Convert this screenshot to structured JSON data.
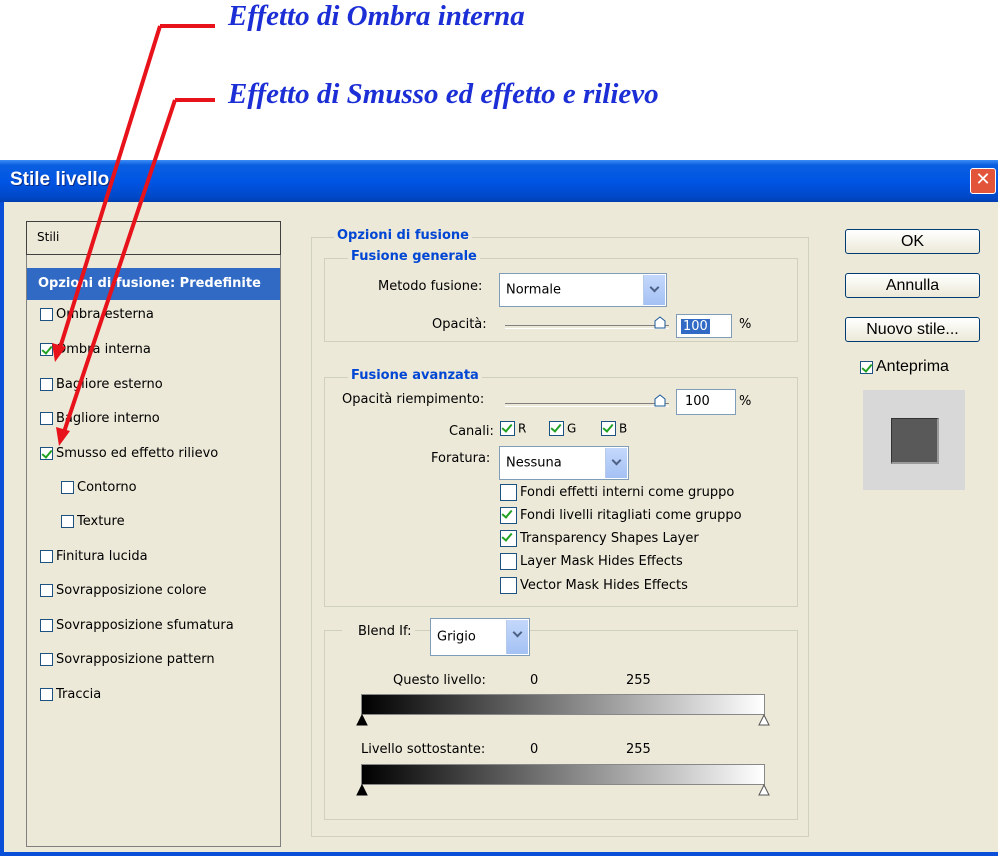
{
  "annotations": {
    "inner_shadow": "Effetto di Ombra interna",
    "bevel_emboss": "Effetto di Smusso ed effetto e rilievo"
  },
  "dialog": {
    "title": "Stile livello",
    "close_glyph": "✕"
  },
  "left_panel": {
    "header": "Stili",
    "selected": "Opzioni di fusione: Predefinite",
    "items": [
      {
        "label": "Ombra esterna",
        "checked": false
      },
      {
        "label": "Ombra interna",
        "checked": true
      },
      {
        "label": "Bagliore esterno",
        "checked": false
      },
      {
        "label": "Bagliore interno",
        "checked": false
      },
      {
        "label": "Smusso ed effetto rilievo",
        "checked": true
      },
      {
        "label": "Contorno",
        "checked": false
      },
      {
        "label": "Texture",
        "checked": false
      },
      {
        "label": "Finitura lucida",
        "checked": false
      },
      {
        "label": "Sovrapposizione colore",
        "checked": false
      },
      {
        "label": "Sovrapposizione sfumatura",
        "checked": false
      },
      {
        "label": "Sovrapposizione pattern",
        "checked": false
      },
      {
        "label": "Traccia",
        "checked": false
      }
    ]
  },
  "blending": {
    "group_title": "Opzioni di fusione",
    "general": {
      "title": "Fusione generale",
      "mode_label": "Metodo fusione:",
      "mode_value": "Normale",
      "opacity_label": "Opacità:",
      "opacity_value": "100",
      "opacity_unit": "%",
      "opacity_level": 100
    },
    "advanced": {
      "title": "Fusione avanzata",
      "fill_label": "Opacità riempimento:",
      "fill_value": "100",
      "fill_unit": "%",
      "fill_level": 100,
      "channels_label": "Canali:",
      "channels": [
        {
          "label": "R",
          "checked": true
        },
        {
          "label": "G",
          "checked": true
        },
        {
          "label": "B",
          "checked": true
        }
      ],
      "knockout_label": "Foratura:",
      "knockout_value": "Nessuna",
      "options": [
        {
          "label": "Fondi effetti interni come gruppo",
          "checked": false
        },
        {
          "label": "Fondi livelli ritagliati come gruppo",
          "checked": true
        },
        {
          "label": "Transparency Shapes Layer",
          "checked": true
        },
        {
          "label": "Layer Mask Hides Effects",
          "checked": false
        },
        {
          "label": "Vector Mask Hides Effects",
          "checked": false
        }
      ]
    },
    "blend_if": {
      "label": "Blend If:",
      "value": "Grigio",
      "this_layer_label": "Questo livello:",
      "this_layer_min": "0",
      "this_layer_max": "255",
      "underlying_label": "Livello sottostante:",
      "underlying_min": "0",
      "underlying_max": "255"
    }
  },
  "buttons": {
    "ok": "OK",
    "cancel": "Annulla",
    "new_style": "Nuovo stile...",
    "preview_label": "Anteprima",
    "preview_checked": true
  },
  "colors": {
    "annotation_text": "#1c2fd6",
    "annotation_arrow": "#e8121b",
    "titlebar": "#0055e5",
    "selection": "#316ac5",
    "section_title": "#0046d5",
    "dialog_bg": "#ece9d8"
  }
}
